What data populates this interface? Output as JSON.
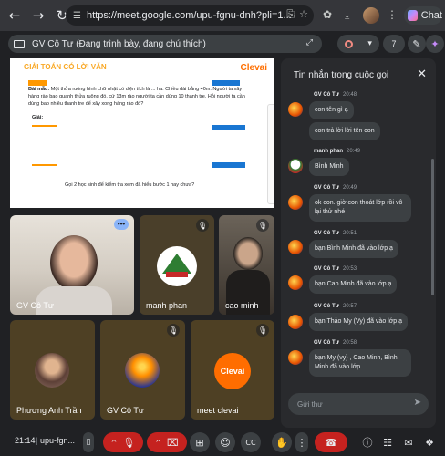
{
  "browser": {
    "url": "https://meet.google.com/upu-fgnu-dnh?pli=1...",
    "chat_button_label": "Chat"
  },
  "meet": {
    "presenting_label": "GV Cô Tư (Đang trình bày, đang chú thích)",
    "participant_count": "7"
  },
  "slide": {
    "logo_text": "GIẢI TOÁN CÓ LỜI VĂN",
    "brand": "Clevai",
    "example_label": "Bài mẫu:",
    "problem_text": "Một thửa ruộng hình chữ nhật có diện tích là ... ha. Chiều dài bằng 40m. Người ta xây hàng rào bao quanh thửa ruộng đó, cứ 13m rào người ta cần dùng 10 thanh tre. Hỏi người ta cần dùng bao nhiêu thanh tre để xây xong hàng rào đó?",
    "solution_label": "Giải:",
    "question_text": "Gọi 2 học sinh để kiểm tra xem đã hiểu bước 1 hay chưa?"
  },
  "tiles": [
    {
      "name": "GV Cô Tư"
    },
    {
      "name": "manh phan"
    },
    {
      "name": "cao minh"
    },
    {
      "name": "Phương Anh Trần"
    },
    {
      "name": "GV Cô Tư"
    },
    {
      "name": "meet clevai"
    }
  ],
  "chat": {
    "title": "Tin nhắn trong cuộc gọi",
    "input_placeholder": "Gửi thư",
    "messages": [
      {
        "author": "GV Cô Tư",
        "time": "20:48",
        "lines": [
          "con tên gì ạ",
          "con trả lời lời tên con"
        ]
      },
      {
        "author": "manh phan",
        "time": "20:49",
        "lines": [
          "Bình Minh"
        ]
      },
      {
        "author": "GV Cô Tư",
        "time": "20:49",
        "lines": [
          "ok con. giờ con thoát lớp rồi vô lại thử nhé"
        ]
      },
      {
        "author": "GV Cô Tư",
        "time": "20:51",
        "lines": [
          "bạn Bình Minh đã vào lớp ạ"
        ]
      },
      {
        "author": "GV Cô Tư",
        "time": "20:53",
        "lines": [
          "bạn Cao Minh đã vào lớp ạ"
        ]
      },
      {
        "author": "GV Cô Tư",
        "time": "20:57",
        "lines": [
          "bạn Thảo My (Vy) đã vào lớp ạ"
        ]
      },
      {
        "author": "GV Cô Tư",
        "time": "20:58",
        "lines": [
          "bạn My (vy) , Cao Minh, Bình Minh đã vào lớp"
        ]
      }
    ]
  },
  "bottom": {
    "time": "21:14",
    "meeting_code": "upu-fgn..."
  },
  "colors": {
    "end_call": "#c5221f",
    "accent": "#8ab4f8"
  }
}
